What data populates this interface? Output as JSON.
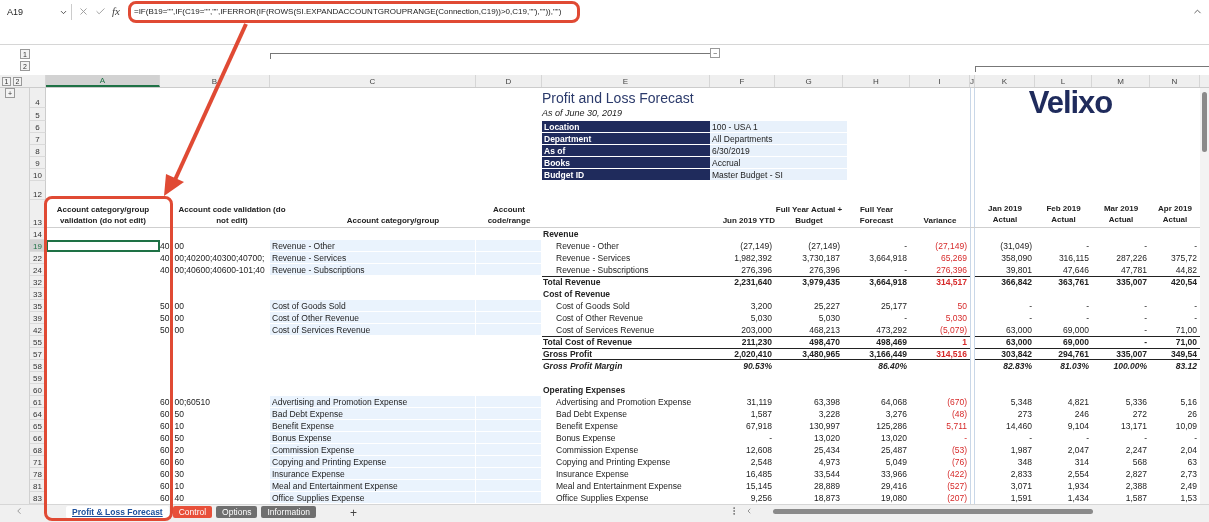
{
  "formula_bar": {
    "name_box": "A19",
    "fx": "fx",
    "formula": "=IF(B19=\"\",IF(C19=\"\",\"\",IFERROR(IF(ROWS(SI.EXPANDACCOUNTGROUPRANGE(Connection,C19))>0,C19,\"\"),\"\")),\"\")"
  },
  "outline": {
    "column_levels": [
      "1",
      "2"
    ],
    "row_levels": [
      "1",
      "2"
    ],
    "collapse": "−",
    "expand": "+"
  },
  "column_headers": [
    {
      "label": "A",
      "selected": true
    },
    {
      "label": "B",
      "selected": false
    },
    {
      "label": "C",
      "selected": false
    },
    {
      "label": "D",
      "selected": false
    },
    {
      "label": "E",
      "selected": false
    },
    {
      "label": "F",
      "selected": false
    },
    {
      "label": "G",
      "selected": false
    },
    {
      "label": "H",
      "selected": false
    },
    {
      "label": "I",
      "selected": false
    },
    {
      "label": "J",
      "selected": false
    },
    {
      "label": "K",
      "selected": false
    },
    {
      "label": "L",
      "selected": false
    },
    {
      "label": "M",
      "selected": false
    },
    {
      "label": "N",
      "selected": false
    }
  ],
  "report": {
    "title_rows": [
      "4",
      "5",
      "6",
      "7",
      "8",
      "9",
      "10",
      "12"
    ],
    "title": "Profit and Loss Forecast",
    "subtitle": "As of June 30, 2019",
    "logo": "Velixo",
    "info": [
      {
        "label": "Location",
        "value": "100 - USA 1"
      },
      {
        "label": "Department",
        "value": "All Departments"
      },
      {
        "label": "As of",
        "value": "6/30/2019"
      },
      {
        "label": "Books",
        "value": "Accrual"
      },
      {
        "label": "Budget ID",
        "value": "Master Budget - SI"
      }
    ]
  },
  "table_header": {
    "row": "13",
    "account_columns": [
      "Account category/group validation (do not edit)",
      "Account code validation (do not edit)",
      "Account category/group",
      "Account code/range"
    ],
    "value_columns": [
      {
        "label": "Jun 2019 YTD",
        "kind": "amount"
      },
      {
        "label": "Full Year Actual + Budget",
        "kind": "amount"
      },
      {
        "label": "Full Year Forecast",
        "kind": "amount"
      },
      {
        "label": "Variance",
        "kind": "variance"
      },
      {
        "label": "Jan 2019 Actual",
        "kind": "month"
      },
      {
        "label": "Feb 2019 Actual",
        "kind": "month"
      },
      {
        "label": "Mar 2019 Actual",
        "kind": "month"
      },
      {
        "label": "Apr 2019 Actual",
        "kind": "month"
      }
    ]
  },
  "rows": [
    {
      "row": "14",
      "selected": false,
      "kind": "section",
      "label": "Revenue"
    },
    {
      "row": "19",
      "selected": true,
      "kind": "line",
      "code": [
        "40",
        "00"
      ],
      "group": "Revenue - Other",
      "label": "Revenue - Other",
      "values": [
        "(27,149)",
        "(27,149)",
        "-",
        "(27,149)",
        "(31,049)",
        "-",
        "-",
        "-"
      ]
    },
    {
      "row": "22",
      "selected": false,
      "kind": "line",
      "code": [
        "40",
        "00;40200;40300;40700;"
      ],
      "group": "Revenue - Services",
      "label": "Revenue - Services",
      "values": [
        "1,982,392",
        "3,730,187",
        "3,664,918",
        "65,269",
        "358,090",
        "316,115",
        "287,226",
        "375,72"
      ]
    },
    {
      "row": "24",
      "selected": false,
      "kind": "line",
      "code": [
        "40",
        "00;40600;40600-101;40"
      ],
      "group": "Revenue - Subscriptions",
      "label": "Revenue - Subscriptions",
      "values": [
        "276,396",
        "276,396",
        "-",
        "276,396",
        "39,801",
        "47,646",
        "47,781",
        "44,82"
      ]
    },
    {
      "row": "32",
      "selected": false,
      "kind": "total",
      "label": "Total Revenue",
      "values": [
        "2,231,640",
        "3,979,435",
        "3,664,918",
        "314,517",
        "366,842",
        "363,761",
        "335,007",
        "420,54"
      ]
    },
    {
      "row": "33",
      "selected": false,
      "kind": "section",
      "label": "Cost of Revenue"
    },
    {
      "row": "35",
      "selected": false,
      "kind": "line",
      "code": [
        "50",
        "00"
      ],
      "group": "Cost of Goods Sold",
      "label": "Cost of Goods Sold",
      "values": [
        "3,200",
        "25,227",
        "25,177",
        "50",
        "-",
        "-",
        "-",
        "-"
      ]
    },
    {
      "row": "39",
      "selected": false,
      "kind": "line",
      "code": [
        "50",
        "00"
      ],
      "group": "Cost of Other Revenue",
      "label": "Cost of Other Revenue",
      "values": [
        "5,030",
        "5,030",
        "-",
        "5,030",
        "-",
        "-",
        "-",
        "-"
      ]
    },
    {
      "row": "42",
      "selected": false,
      "kind": "line",
      "code": [
        "50",
        "00"
      ],
      "group": "Cost of Services Revenue",
      "label": "Cost of Services Revenue",
      "values": [
        "203,000",
        "468,213",
        "473,292",
        "(5,079)",
        "63,000",
        "69,000",
        "-",
        "71,00"
      ]
    },
    {
      "row": "55",
      "selected": false,
      "kind": "total",
      "label": "Total Cost of Revenue",
      "values": [
        "211,230",
        "498,470",
        "498,469",
        "1",
        "63,000",
        "69,000",
        "-",
        "71,00"
      ]
    },
    {
      "row": "57",
      "selected": false,
      "kind": "gross",
      "label": "Gross Profit",
      "values": [
        "2,020,410",
        "3,480,965",
        "3,166,449",
        "314,516",
        "303,842",
        "294,761",
        "335,007",
        "349,54"
      ]
    },
    {
      "row": "58",
      "selected": false,
      "kind": "margin",
      "label": "Gross Profit Margin",
      "values": [
        "90.53%",
        "86.40%",
        "82.83%",
        "81.03%",
        "100.00%",
        "83.12"
      ]
    },
    {
      "row": "59",
      "selected": false,
      "kind": "blank"
    },
    {
      "row": "60",
      "selected": false,
      "kind": "section",
      "label": "Operating Expenses"
    },
    {
      "row": "61",
      "selected": false,
      "kind": "line",
      "code": [
        "60",
        "00;60510"
      ],
      "group": "Advertising and Promotion Expense",
      "label": "Advertising and Promotion Expense",
      "values": [
        "31,119",
        "63,398",
        "64,068",
        "(670)",
        "5,348",
        "4,821",
        "5,336",
        "5,16"
      ]
    },
    {
      "row": "64",
      "selected": false,
      "kind": "line",
      "code": [
        "60",
        "50"
      ],
      "group": "Bad Debt Expense",
      "label": "Bad Debt Expense",
      "values": [
        "1,587",
        "3,228",
        "3,276",
        "(48)",
        "273",
        "246",
        "272",
        "26"
      ]
    },
    {
      "row": "65",
      "selected": false,
      "kind": "line",
      "code": [
        "60",
        "10"
      ],
      "group": "Benefit Expense",
      "label": "Benefit Expense",
      "values": [
        "67,918",
        "130,997",
        "125,286",
        "5,711",
        "14,460",
        "9,104",
        "13,171",
        "10,09"
      ]
    },
    {
      "row": "66",
      "selected": false,
      "kind": "line",
      "code": [
        "60",
        "50"
      ],
      "group": "Bonus Expense",
      "label": "Bonus Expense",
      "values": [
        "-",
        "13,020",
        "13,020",
        "-",
        "-",
        "-",
        "-",
        "-"
      ]
    },
    {
      "row": "68",
      "selected": false,
      "kind": "line",
      "code": [
        "60",
        "20"
      ],
      "group": "Commission Expense",
      "label": "Commission Expense",
      "values": [
        "12,608",
        "25,434",
        "25,487",
        "(53)",
        "1,987",
        "2,047",
        "2,247",
        "2,04"
      ]
    },
    {
      "row": "71",
      "selected": false,
      "kind": "line",
      "code": [
        "60",
        "60"
      ],
      "group": "Copying and Printing Expense",
      "label": "Copying and Printing Expense",
      "values": [
        "2,548",
        "4,973",
        "5,049",
        "(76)",
        "348",
        "314",
        "568",
        "63"
      ]
    },
    {
      "row": "78",
      "selected": false,
      "kind": "line",
      "code": [
        "60",
        "30"
      ],
      "group": "Insurance Expense",
      "label": "Insurance Expense",
      "values": [
        "16,485",
        "33,544",
        "33,966",
        "(422)",
        "2,833",
        "2,554",
        "2,827",
        "2,73"
      ]
    },
    {
      "row": "81",
      "selected": false,
      "kind": "line",
      "code": [
        "60",
        "10"
      ],
      "group": "Meal and Entertainment Expense",
      "label": "Meal and Entertainment Expense",
      "values": [
        "15,145",
        "28,889",
        "29,416",
        "(527)",
        "3,071",
        "1,934",
        "2,388",
        "2,49"
      ]
    },
    {
      "row": "83",
      "selected": false,
      "kind": "line",
      "code": [
        "60",
        "40"
      ],
      "group": "Office Supplies Expense",
      "label": "Office Supplies Expense",
      "values": [
        "9,256",
        "18,873",
        "19,080",
        "(207)",
        "1,591",
        "1,434",
        "1,587",
        "1,53"
      ]
    }
  ],
  "sheet_tabs": [
    {
      "label": "Profit & Loss Forecast",
      "selected": true,
      "color": "#ffffff"
    },
    {
      "label": "Control",
      "selected": false,
      "color": "#e8503a"
    },
    {
      "label": "Options",
      "selected": false,
      "color": "#6f6f6f"
    },
    {
      "label": "Information",
      "selected": false,
      "color": "#6f6f6f"
    }
  ],
  "add_sheet": "+"
}
